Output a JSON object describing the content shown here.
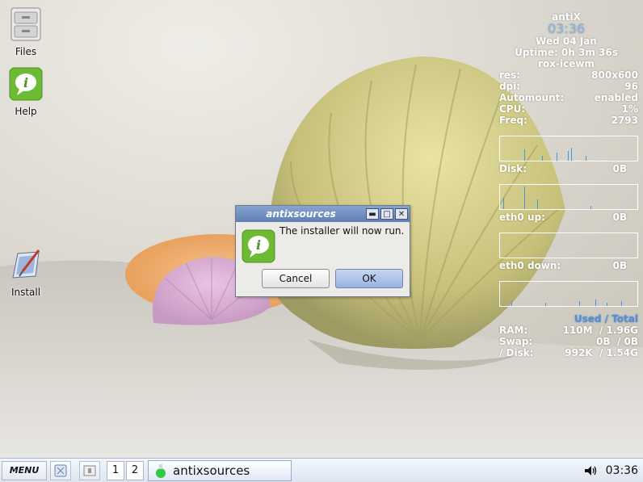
{
  "desktop": {
    "icons": [
      {
        "label": "Files",
        "icon": "file-cabinet-icon"
      },
      {
        "label": "Help",
        "icon": "info-bubble-icon"
      },
      {
        "label": "Install",
        "icon": "installer-icon"
      }
    ]
  },
  "conky": {
    "hostname": "antiX",
    "time": "03:36",
    "date": "Wed 04 Jan",
    "uptime": "Uptime: 0h 3m 36s",
    "wm": "rox-icewm",
    "stats": [
      {
        "label": "res:",
        "value": "800x600"
      },
      {
        "label": "dpi:",
        "value": "96"
      },
      {
        "label": "Automount:",
        "value": "enabled"
      },
      {
        "label": "CPU:",
        "value": "1%"
      },
      {
        "label": "Freq:",
        "value": "2793"
      }
    ],
    "disk": {
      "label": "Disk:",
      "value": "0B"
    },
    "eth_up": {
      "label": "eth0 up:",
      "value": "0B"
    },
    "eth_down": {
      "label": "eth0 down:",
      "value": "0B"
    },
    "usage_header": "Used / Total",
    "usage": [
      {
        "label": "RAM:",
        "used": "110M",
        "total": "/ 1.96G"
      },
      {
        "label": "Swap:",
        "used": "0B",
        "total": "/ 0B"
      },
      {
        "label": "/ Disk:",
        "used": "992K",
        "total": "/ 1.54G"
      }
    ],
    "accent": "#4a90e2"
  },
  "dialog": {
    "title": "antixsources",
    "message": "The installer will now run.",
    "cancel_label": "Cancel",
    "ok_label": "OK",
    "icon": "info-bubble-icon"
  },
  "taskbar": {
    "menu_label": "MENU",
    "workspaces": [
      "1",
      "2"
    ],
    "task_label": "antixsources",
    "clock": "03:36"
  }
}
